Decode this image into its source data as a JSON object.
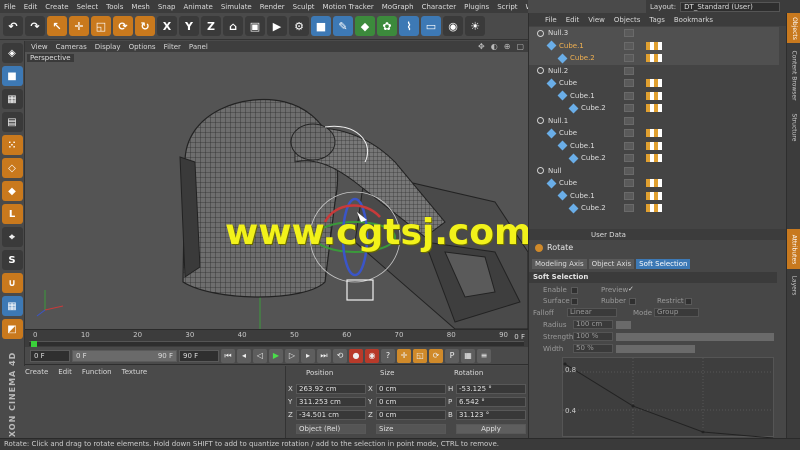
{
  "menu": [
    "File",
    "Edit",
    "Create",
    "Select",
    "Tools",
    "Mesh",
    "Snap",
    "Animate",
    "Simulate",
    "Render",
    "Sculpt",
    "Motion Tracker",
    "MoGraph",
    "Character",
    "Plugins",
    "Script",
    "Window",
    "Help"
  ],
  "layout": {
    "label": "Layout:",
    "value": "DT_Standard (User)"
  },
  "viewport": {
    "menu": [
      "View",
      "Cameras",
      "Display",
      "Options",
      "Filter",
      "Panel"
    ],
    "label": "Perspective",
    "watermark": "www.cgtsj.com"
  },
  "timeline": {
    "ticks": [
      "0",
      "10",
      "20",
      "30",
      "40",
      "50",
      "60",
      "70",
      "80",
      "90"
    ],
    "end_label": "0 F"
  },
  "playback": {
    "current": "0 F",
    "min": "0 F",
    "max_slider": "90 F",
    "max": "90 F"
  },
  "material_menu": [
    "Create",
    "Edit",
    "Function",
    "Texture"
  ],
  "brand": "MAXON CINEMA 4D",
  "coords": {
    "headers": [
      "Position",
      "Size",
      "Rotation"
    ],
    "rows": [
      {
        "axis": "X",
        "pos": "263.92 cm",
        "size_axis": "X",
        "size": "0 cm",
        "rot_axis": "H",
        "rot": "-53.125 °"
      },
      {
        "axis": "Y",
        "pos": "311.253 cm",
        "size_axis": "Y",
        "size": "0 cm",
        "rot_axis": "P",
        "rot": "6.542 °"
      },
      {
        "axis": "Z",
        "pos": "-34.501 cm",
        "size_axis": "Z",
        "size": "0 cm",
        "rot_axis": "B",
        "rot": "31.123 °"
      }
    ],
    "mode": "Object (Rel)",
    "size_mode": "Size",
    "apply": "Apply"
  },
  "status": "Rotate: Click and drag to rotate elements. Hold down SHIFT to add to quantize rotation / add to the selection in point mode, CTRL to remove.",
  "objects": {
    "menu": [
      "File",
      "Edit",
      "View",
      "Objects",
      "Tags",
      "Bookmarks"
    ],
    "items": [
      {
        "name": "Null.3",
        "depth": 0,
        "type": "null",
        "selected": true
      },
      {
        "name": "Cube.1",
        "depth": 1,
        "type": "cube",
        "selected": true
      },
      {
        "name": "Cube.2",
        "depth": 2,
        "type": "cube",
        "selected": true
      },
      {
        "name": "Null.2",
        "depth": 0,
        "type": "null",
        "selected": false
      },
      {
        "name": "Cube",
        "depth": 1,
        "type": "cube",
        "selected": false
      },
      {
        "name": "Cube.1",
        "depth": 2,
        "type": "cube",
        "selected": false
      },
      {
        "name": "Cube.2",
        "depth": 3,
        "type": "cube",
        "selected": false
      },
      {
        "name": "Null.1",
        "depth": 0,
        "type": "null",
        "selected": false
      },
      {
        "name": "Cube",
        "depth": 1,
        "type": "cube",
        "selected": false
      },
      {
        "name": "Cube.1",
        "depth": 2,
        "type": "cube",
        "selected": false
      },
      {
        "name": "Cube.2",
        "depth": 3,
        "type": "cube",
        "selected": false
      },
      {
        "name": "Null",
        "depth": 0,
        "type": "null",
        "selected": false
      },
      {
        "name": "Cube",
        "depth": 1,
        "type": "cube",
        "selected": false
      },
      {
        "name": "Cube.1",
        "depth": 2,
        "type": "cube",
        "selected": false
      },
      {
        "name": "Cube.2",
        "depth": 3,
        "type": "cube",
        "selected": false
      }
    ]
  },
  "side_tabs_top": [
    "Objects",
    "Content Browser",
    "Structure"
  ],
  "side_tabs_bottom": [
    "Attributes",
    "Layers"
  ],
  "attributes": {
    "menu": "User Data",
    "title": "Rotate",
    "tabs": [
      "Modeling Axis",
      "Object Axis",
      "Soft Selection"
    ],
    "section": "Soft Selection",
    "enable": "Enable",
    "preview": "Preview",
    "surface": "Surface",
    "rubber": "Rubber",
    "restrict": "Restrict",
    "falloff_label": "Falloff",
    "falloff": "Linear",
    "mode_label": "Mode",
    "mode": "Group",
    "radius_label": "Radius",
    "radius": "100 cm",
    "strength_label": "Strength",
    "strength": "100 %",
    "width_label": "Width",
    "width": "50 %",
    "graph_y1": "0.8",
    "graph_y2": "0.4"
  }
}
